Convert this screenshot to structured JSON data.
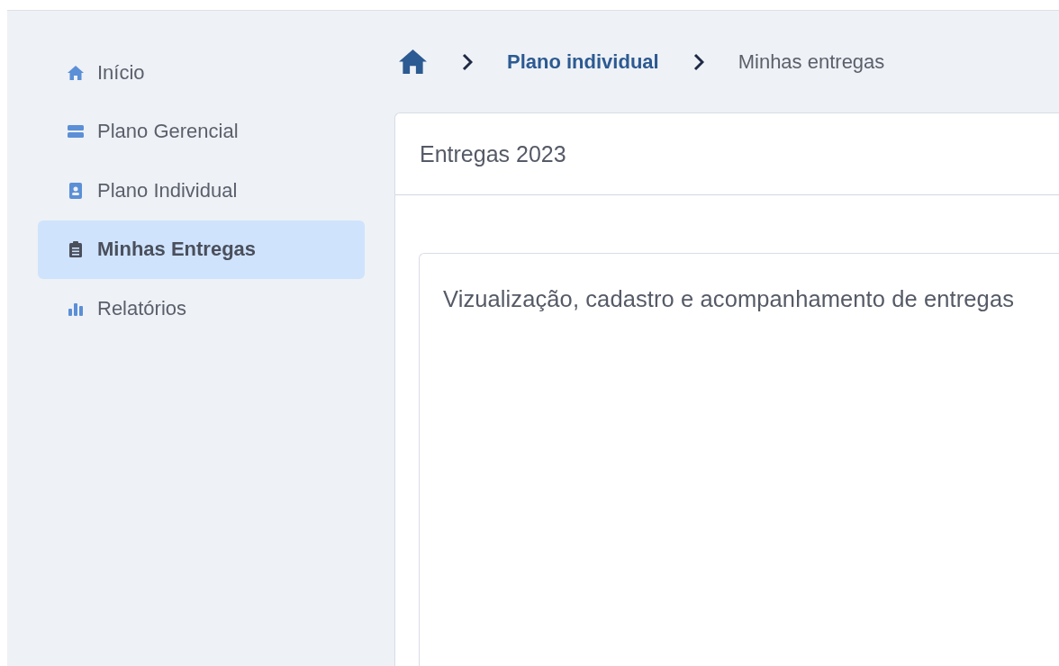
{
  "sidebar": {
    "items": [
      {
        "label": "Início",
        "selected": false
      },
      {
        "label": "Plano Gerencial",
        "selected": false
      },
      {
        "label": "Plano Individual",
        "selected": false
      },
      {
        "label": "Minhas Entregas",
        "selected": true
      },
      {
        "label": "Relatórios",
        "selected": false
      }
    ]
  },
  "breadcrumb": {
    "items": [
      "Plano individual",
      "Minhas entregas"
    ]
  },
  "card": {
    "title": "Entregas 2023",
    "panel_title": "Vizualização, cadastro e acompanhamento de entregas"
  }
}
